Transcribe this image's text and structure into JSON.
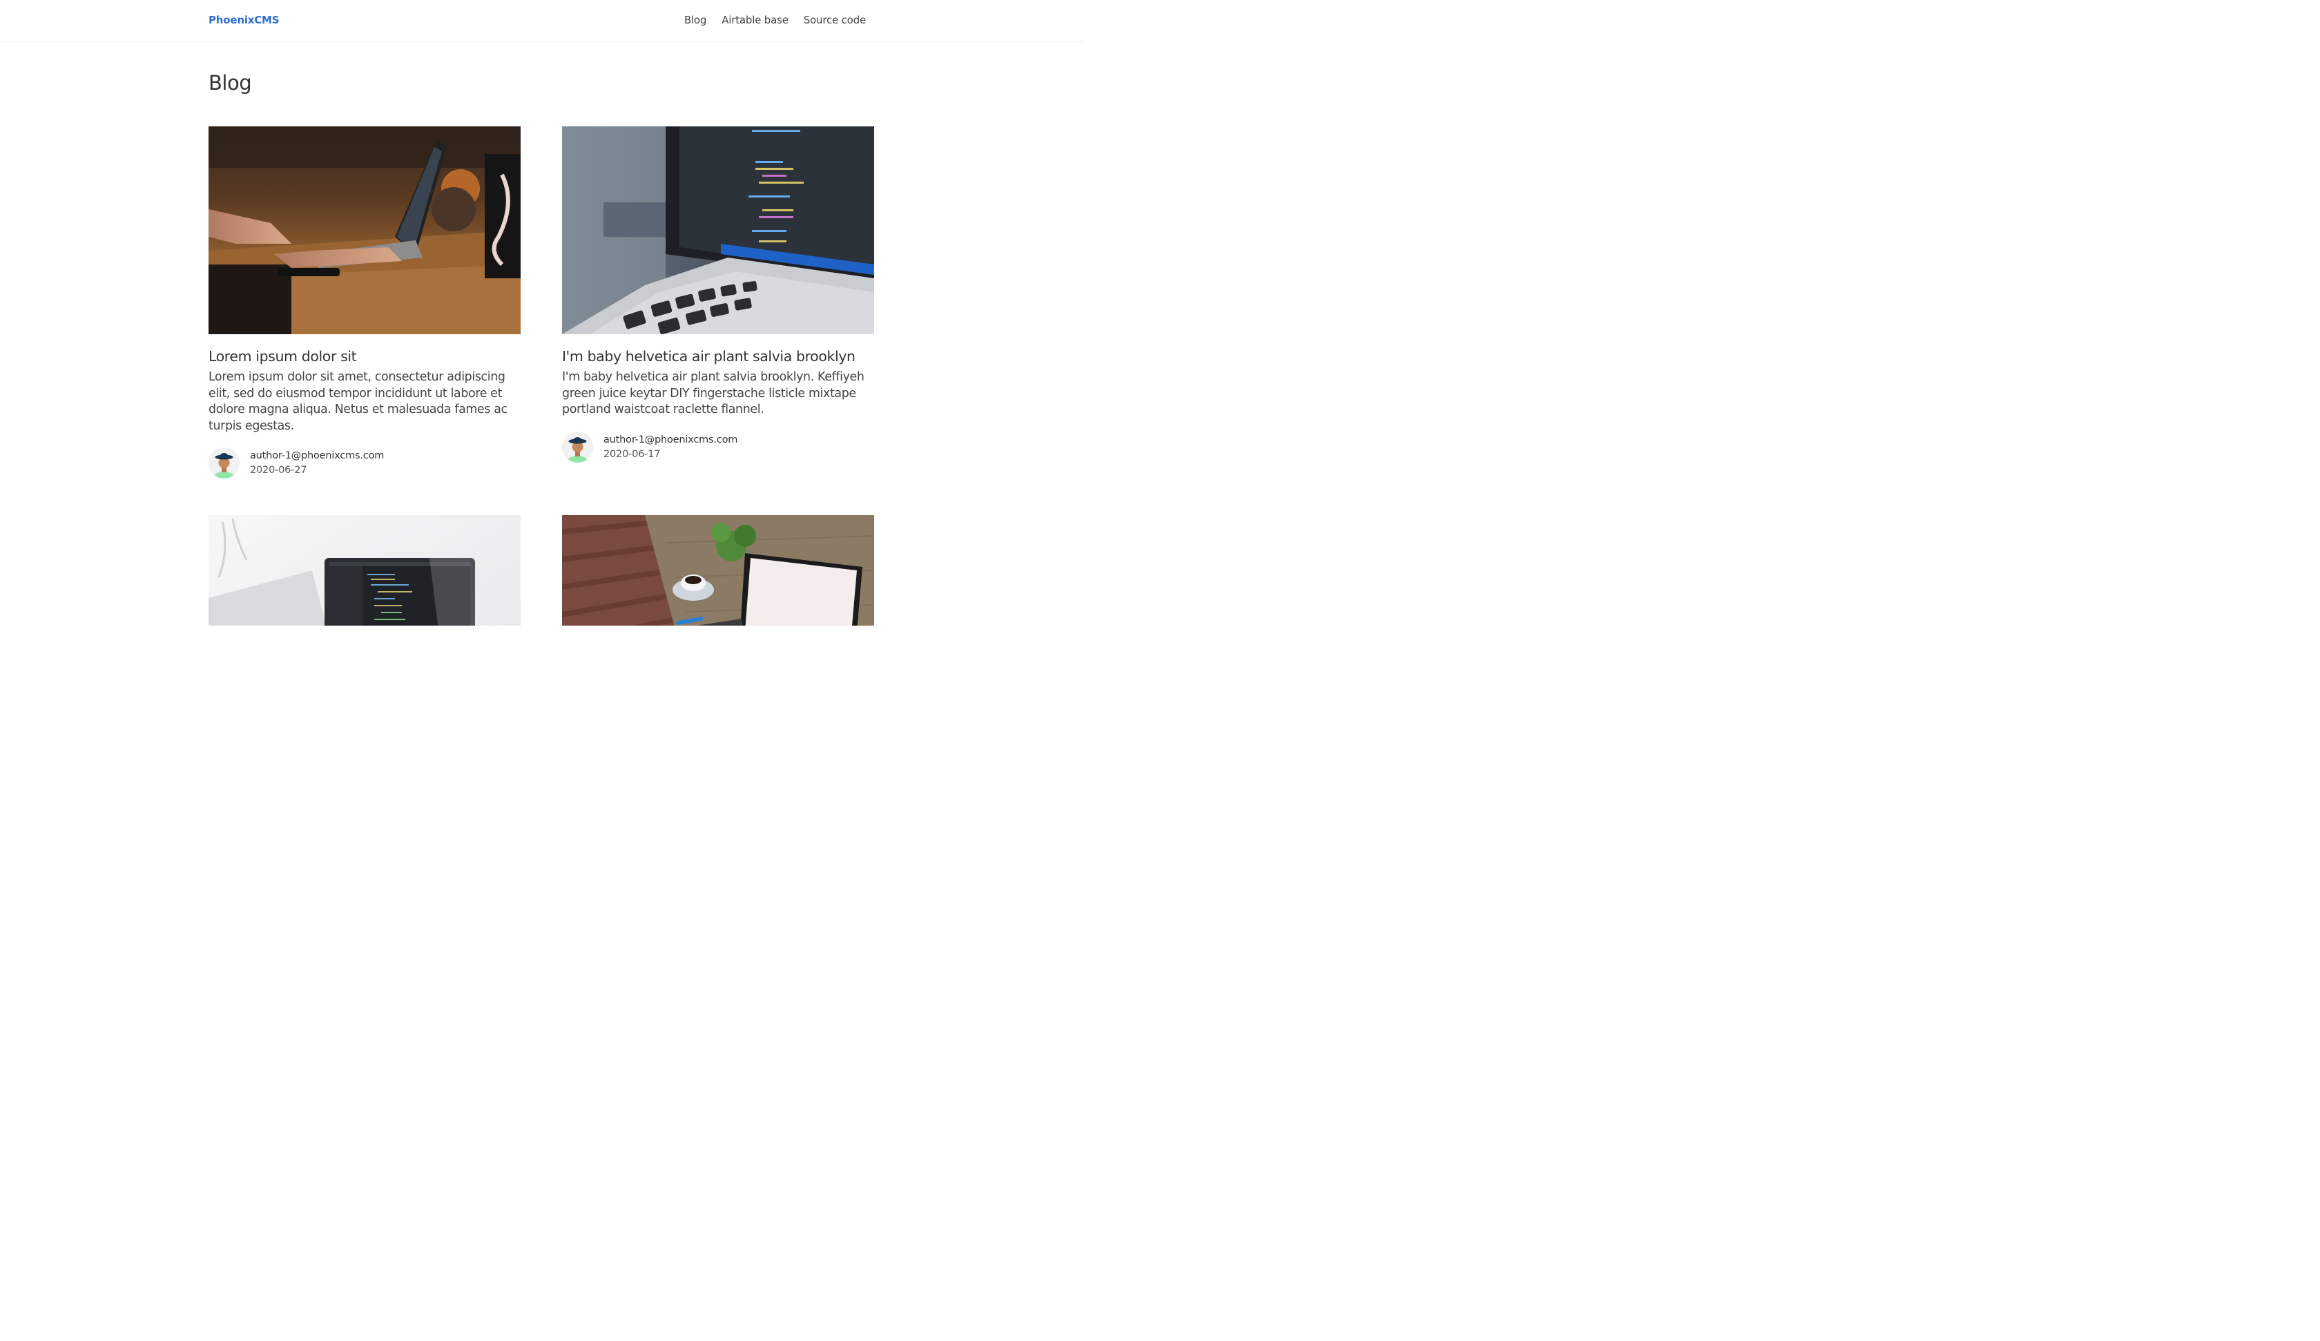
{
  "header": {
    "brand": "PhoenixCMS",
    "nav": [
      {
        "label": "Blog"
      },
      {
        "label": "Airtable base"
      },
      {
        "label": "Source code"
      }
    ]
  },
  "page": {
    "title": "Blog"
  },
  "posts": [
    {
      "title": "Lorem ipsum dolor sit",
      "excerpt": "Lorem ipsum dolor sit amet, consectetur adipiscing elit, sed do eiusmod tempor incididunt ut labore et dolore magna aliqua. Netus et malesuada fames ac turpis egestas.",
      "author": "author-1@phoenixcms.com",
      "date": "2020-06-27"
    },
    {
      "title": "I'm baby helvetica air plant salvia brooklyn",
      "excerpt": "I'm baby helvetica air plant salvia brooklyn. Keffiyeh green juice keytar DIY fingerstache listicle mixtape portland waistcoat raclette flannel.",
      "author": "author-1@phoenixcms.com",
      "date": "2020-06-17"
    },
    {
      "title": "",
      "excerpt": "",
      "author": "",
      "date": ""
    },
    {
      "title": "",
      "excerpt": "",
      "author": "",
      "date": ""
    }
  ],
  "colors": {
    "brand": "#2f6fd0",
    "text": "#333333",
    "border": "#e9e9e9"
  }
}
